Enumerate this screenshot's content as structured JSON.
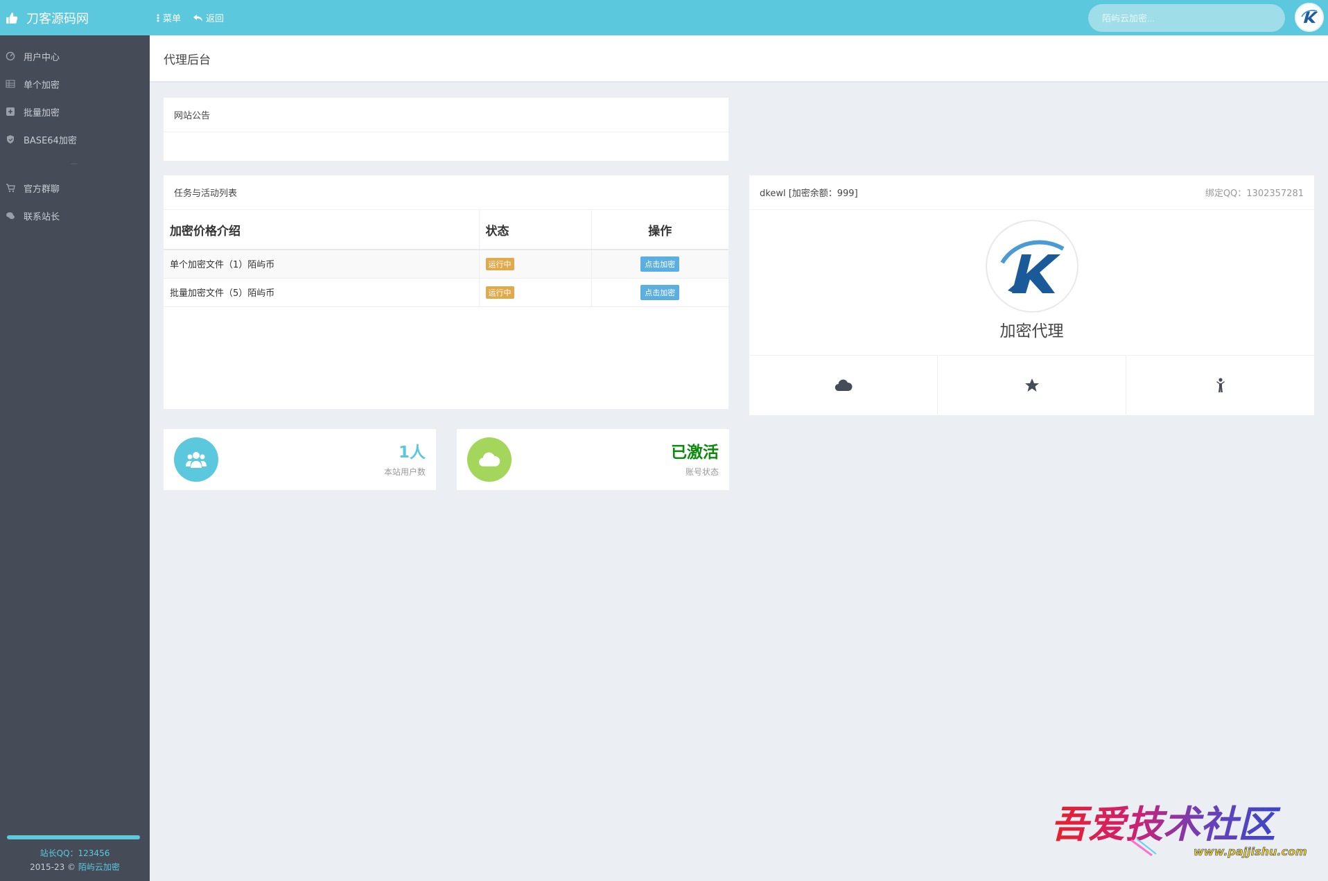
{
  "topbar": {
    "brand": "刀客源码网",
    "menu_label": "菜单",
    "back_label": "返回",
    "search_placeholder": "陌屿云加密..."
  },
  "sidebar": {
    "items": [
      {
        "label": "用户中心",
        "icon": "dashboard-icon"
      },
      {
        "label": "单个加密",
        "icon": "grid-icon"
      },
      {
        "label": "批量加密",
        "icon": "plus-square-icon"
      },
      {
        "label": "BASE64加密",
        "icon": "shield-icon"
      }
    ],
    "separator": "—",
    "items2": [
      {
        "label": "官方群聊",
        "icon": "cart-icon"
      },
      {
        "label": "联系站长",
        "icon": "chat-icon"
      }
    ],
    "footer": {
      "qq": "站长QQ：123456",
      "copy_prefix": "2015-23 © ",
      "copy_link": "陌屿云加密"
    }
  },
  "page": {
    "title": "代理后台"
  },
  "notice": {
    "title": "网站公告"
  },
  "tasks": {
    "title": "任务与活动列表",
    "headers": [
      "加密价格介绍",
      "状态",
      "操作"
    ],
    "rows": [
      {
        "name": "单个加密文件（1）陌屿币",
        "status": "运行中",
        "action": "点击加密"
      },
      {
        "name": "批量加密文件（5）陌屿币",
        "status": "运行中",
        "action": "点击加密"
      }
    ]
  },
  "profile": {
    "username": "dkewl [加密余额：999]",
    "bind_qq": "绑定QQ：1302357281",
    "role": "加密代理",
    "actions": [
      "cloud-icon",
      "star-icon",
      "child-icon"
    ]
  },
  "stats": [
    {
      "value": "1人",
      "label": "本站用户数",
      "color": "#5bc8dd",
      "icon": "users-icon"
    },
    {
      "value": "已激活",
      "label": "账号状态",
      "color": "#0a8a0a",
      "icon": "cloud-icon"
    }
  ],
  "watermark": {
    "text": "吾爱技术社区",
    "url": "www.pajjishu.com"
  },
  "colors": {
    "accent": "#5bc8dd",
    "sidebar_bg": "#454c58",
    "badge_warning": "#e0a94a",
    "button_info": "#5aaee0",
    "stat_green_icon": "#a3d65a"
  }
}
